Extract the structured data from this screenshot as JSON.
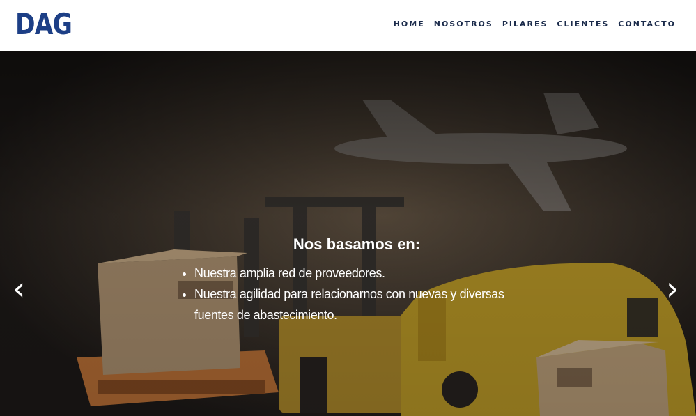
{
  "brand": {
    "logo_text": "DAG"
  },
  "nav": {
    "items": [
      {
        "label": "HOME"
      },
      {
        "label": "NOSOTROS"
      },
      {
        "label": "PILARES"
      },
      {
        "label": "CLIENTES"
      },
      {
        "label": "CONTACTO"
      }
    ]
  },
  "hero": {
    "heading": "Nos basamos en:",
    "bullets": [
      "Nuestra amplia red de proveedores.",
      "Nuestra agilidad para relacionarnos con nuevas y diversas fuentes de abastecimiento."
    ],
    "prev_icon": "chevron-left-icon",
    "next_icon": "chevron-right-icon",
    "prev_glyph": "‹",
    "next_glyph": "›"
  },
  "colors": {
    "brand_blue": "#1d3f86",
    "nav_text": "#1b2b4b"
  }
}
